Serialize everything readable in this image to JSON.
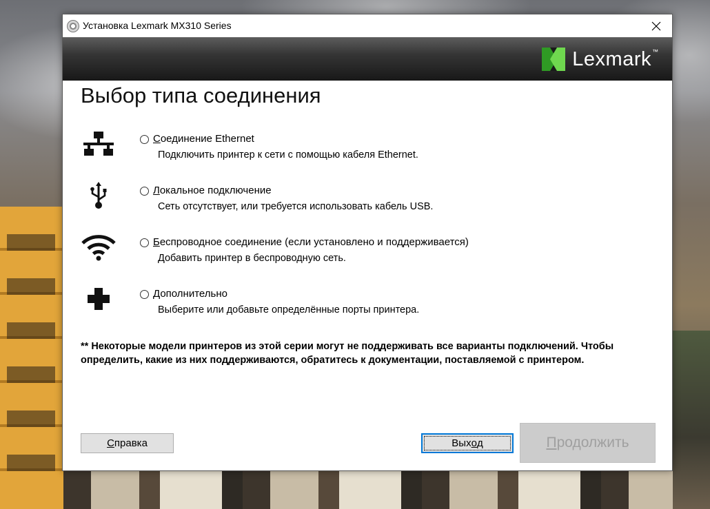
{
  "window": {
    "title": "Установка Lexmark MX310 Series",
    "close_symbol": "✕"
  },
  "header": {
    "logo_text": "Lexmark",
    "logo_tm": "™",
    "brand_green": "#4cbf3a"
  },
  "page": {
    "title": "Выбор типа соединения"
  },
  "options": [
    {
      "icon": "network-icon",
      "label_accel": "С",
      "label_rest": "оединение Ethernet",
      "description": "Подключить принтер к сети с помощью кабеля Ethernet.",
      "selected": false
    },
    {
      "icon": "usb-icon",
      "label_accel": "Л",
      "label_rest": "окальное подключение",
      "description": "Сеть отсутствует, или требуется использовать кабель USB.",
      "selected": false
    },
    {
      "icon": "wifi-icon",
      "label_accel": "Б",
      "label_rest": "еспроводное соединение (если установлено и поддерживается)",
      "description": "Добавить принтер в беспроводную сеть.",
      "selected": false
    },
    {
      "icon": "plus-icon",
      "label_accel": "Д",
      "label_rest": "ополнительно",
      "description": "Выберите или добавьте определённые порты принтера.",
      "selected": false
    }
  ],
  "note": "** Некоторые модели принтеров из этой серии могут не поддерживать все варианты подключений. Чтобы определить, какие из них поддерживаются, обратитесь к документации, поставляемой с принтером.",
  "buttons": {
    "help_accel": "С",
    "help_rest": "правка",
    "exit_pre": "Вых",
    "exit_accel": "о",
    "exit_post": "д",
    "continue_accel": "П",
    "continue_rest": "родолжить"
  }
}
